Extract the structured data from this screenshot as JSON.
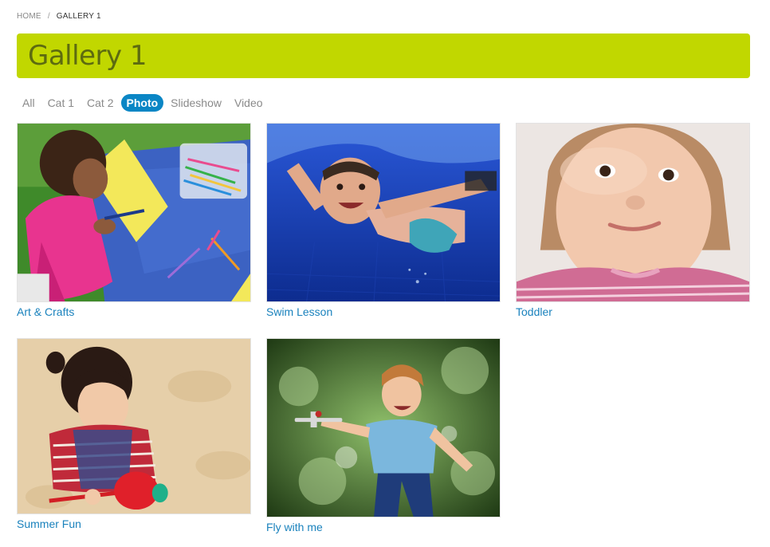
{
  "breadcrumb": {
    "home": "HOME",
    "separator": "/",
    "current": "GALLERY 1"
  },
  "page": {
    "title": "Gallery 1"
  },
  "filters": [
    {
      "label": "All",
      "active": false
    },
    {
      "label": "Cat 1",
      "active": false
    },
    {
      "label": "Cat 2",
      "active": false
    },
    {
      "label": "Photo",
      "active": true
    },
    {
      "label": "Slideshow",
      "active": false
    },
    {
      "label": "Video",
      "active": false
    }
  ],
  "gallery": {
    "items": [
      {
        "caption": "Art & Crafts"
      },
      {
        "caption": "Swim Lesson"
      },
      {
        "caption": "Toddler"
      },
      {
        "caption": "Summer Fun"
      },
      {
        "caption": "Fly with me"
      }
    ]
  },
  "colors": {
    "accent": "#c1d700",
    "title_text": "#5d6b10",
    "link": "#1a82bd",
    "active_filter": "#0a86c5"
  }
}
